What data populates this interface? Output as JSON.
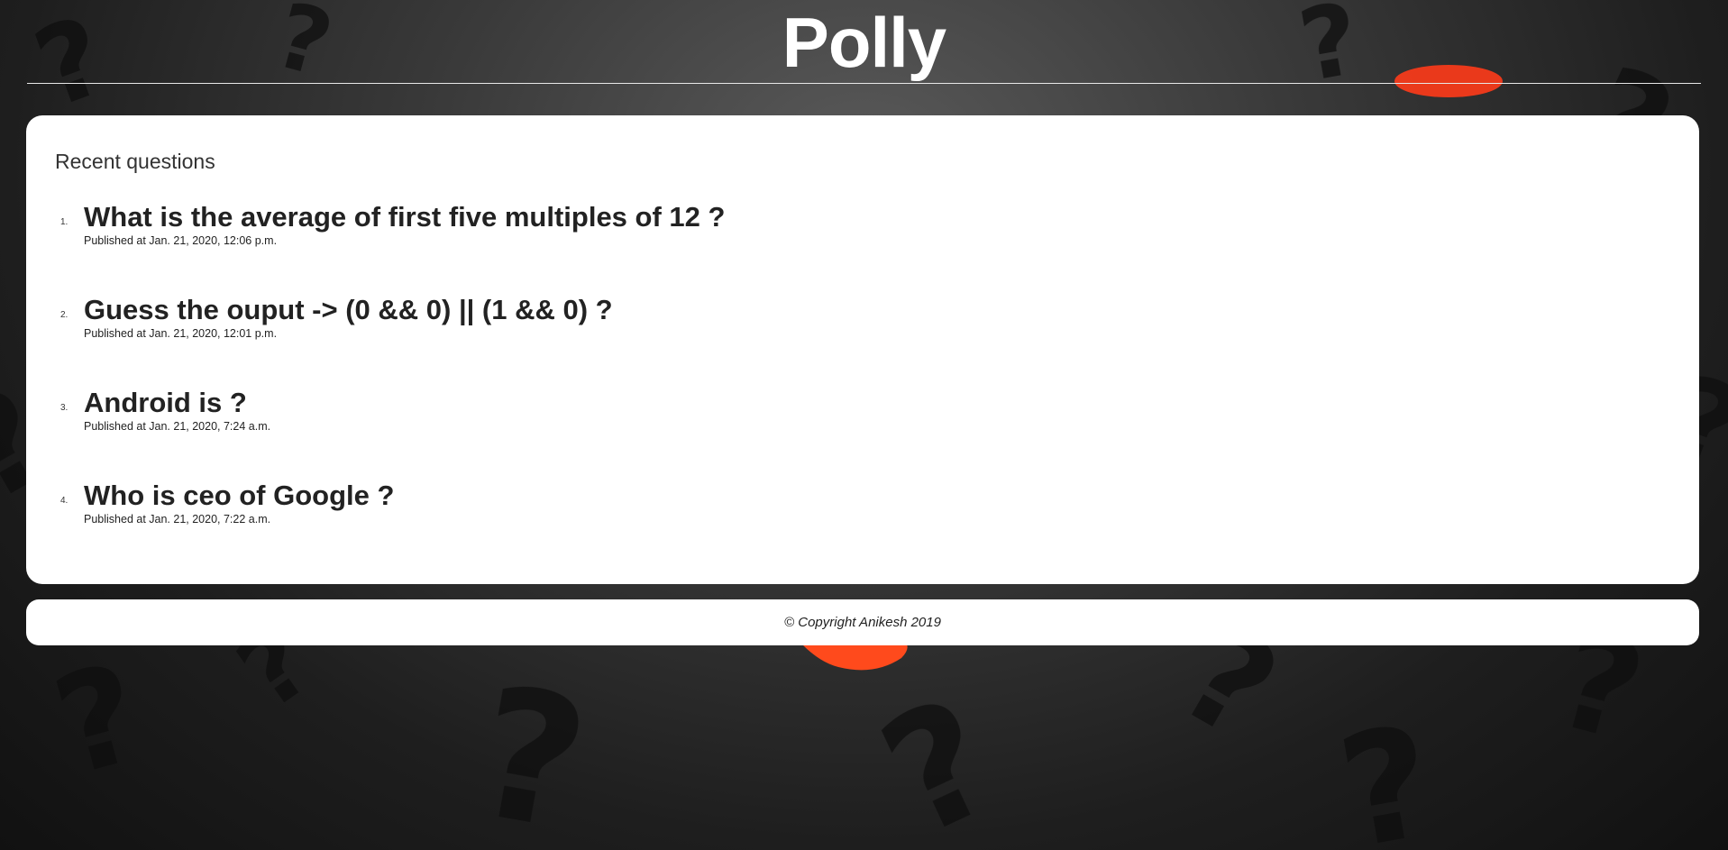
{
  "header": {
    "title": "Polly"
  },
  "main": {
    "section_title": "Recent questions",
    "questions": [
      {
        "number": "1.",
        "title": "What is the average of first five multiples of 12 ?",
        "published": "Published at Jan. 21, 2020, 12:06 p.m."
      },
      {
        "number": "2.",
        "title": "Guess the ouput -> (0 && 0) || (1 && 0) ?",
        "published": "Published at Jan. 21, 2020, 12:01 p.m."
      },
      {
        "number": "3.",
        "title": "Android is ?",
        "published": "Published at Jan. 21, 2020, 7:24 a.m."
      },
      {
        "number": "4.",
        "title": "Who is ceo of Google ?",
        "published": "Published at Jan. 21, 2020, 7:22 a.m."
      }
    ]
  },
  "footer": {
    "copyright": "© Copyright Anikesh 2019"
  },
  "colors": {
    "background": "#2a2a2a",
    "accent": "#ff4a1c",
    "card": "#ffffff"
  }
}
